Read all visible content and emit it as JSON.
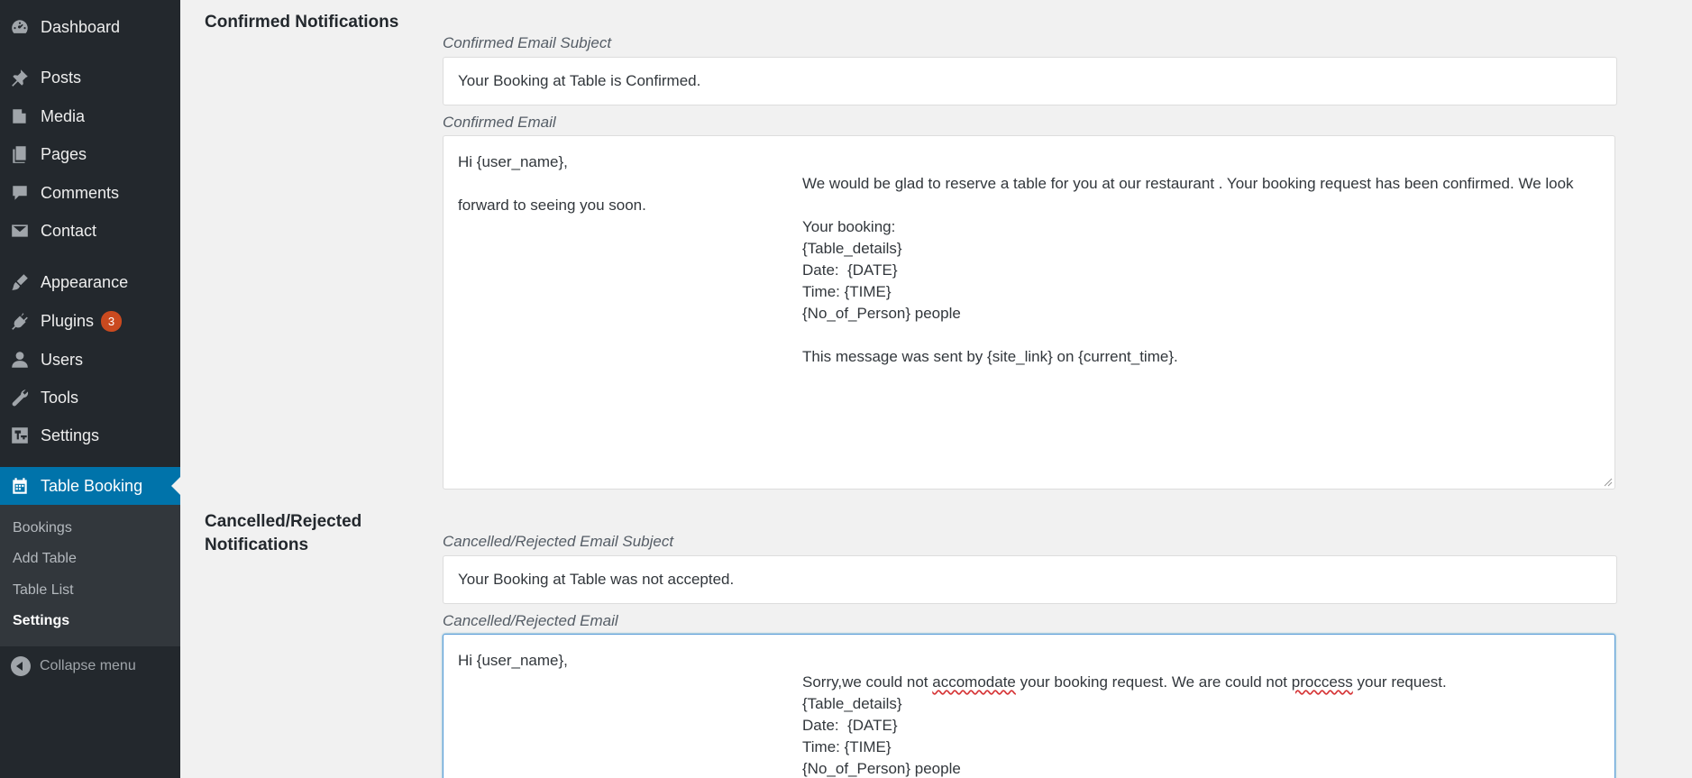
{
  "sidebar": {
    "items": [
      {
        "label": "Dashboard",
        "icon": "dashboard-icon"
      },
      {
        "label": "Posts",
        "icon": "pin-icon"
      },
      {
        "label": "Media",
        "icon": "media-icon"
      },
      {
        "label": "Pages",
        "icon": "pages-icon"
      },
      {
        "label": "Comments",
        "icon": "comment-icon"
      },
      {
        "label": "Contact",
        "icon": "mail-icon"
      },
      {
        "label": "Appearance",
        "icon": "brush-icon"
      },
      {
        "label": "Plugins",
        "icon": "plugin-icon",
        "badge": "3"
      },
      {
        "label": "Users",
        "icon": "user-icon"
      },
      {
        "label": "Tools",
        "icon": "wrench-icon"
      },
      {
        "label": "Settings",
        "icon": "settings-icon"
      },
      {
        "label": "Table Booking",
        "icon": "calendar-icon",
        "active": true
      }
    ],
    "submenu": [
      "Bookings",
      "Add Table",
      "Table List",
      "Settings"
    ],
    "current_submenu": "Settings",
    "collapse_label": "Collapse menu"
  },
  "confirmed": {
    "section_title_line1": "Confirmed Notifications",
    "subject_label": "Confirmed Email Subject",
    "subject_value": "Your Booking at Table is Confirmed.",
    "email_label": "Confirmed Email",
    "email_lines": [
      "Hi {user_name},",
      "We would be glad to reserve a table for you at our restaurant . Your booking request has been confirmed. We look",
      "forward to seeing you soon.",
      "Your booking:",
      "{Table_details}",
      "Date:  {DATE}",
      "Time: {TIME}",
      "{No_of_Person} people",
      "This message was sent by {site_link} on {current_time}."
    ]
  },
  "cancelled": {
    "section_title_line1": "Cancelled/Rejected",
    "section_title_line2": "Notifications",
    "subject_label": "Cancelled/Rejected Email Subject",
    "subject_value": "Your Booking at Table was not accepted.",
    "email_label": "Cancelled/Rejected Email",
    "email_lines": {
      "greeting": "Hi {user_name},",
      "line1_a": "Sorry,we could not ",
      "line1_b": "accomodate",
      "line1_c": " your booking request. We are could not ",
      "line1_d": "proccess",
      "line1_e": " your request.",
      "table_details": "{Table_details}",
      "date": "Date:  {DATE}",
      "time": "Time: {TIME}",
      "people": "{No_of_Person} people"
    }
  },
  "colors": {
    "sidebar_bg": "#23282d",
    "active_bg": "#0073aa",
    "badge_bg": "#ca4a1f",
    "focus_border": "#5b9dd9"
  }
}
